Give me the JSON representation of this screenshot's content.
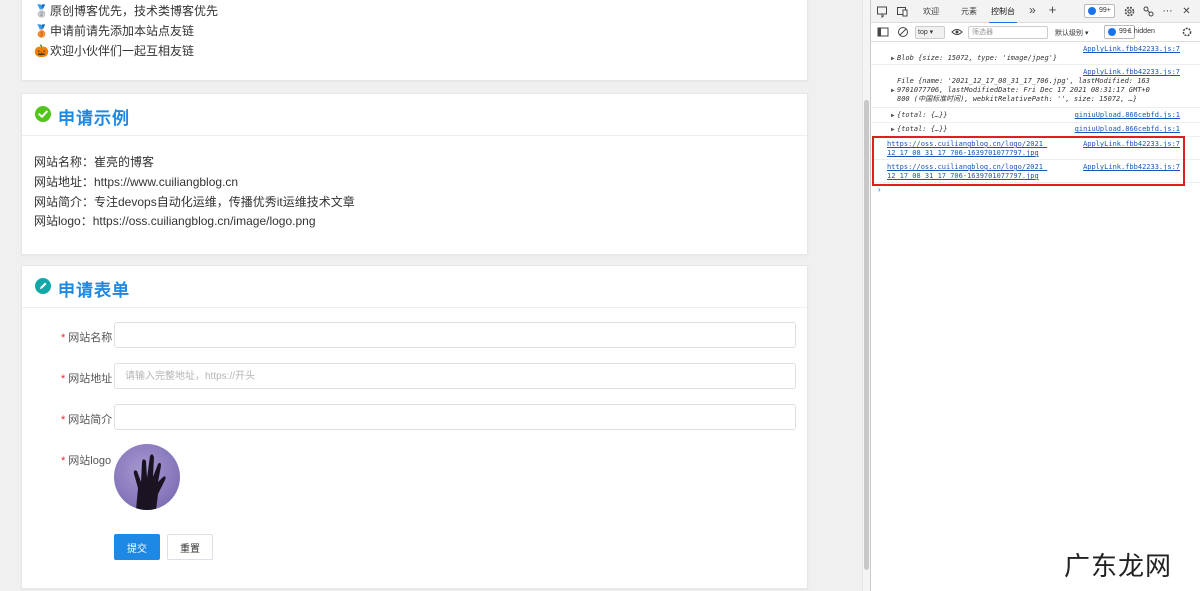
{
  "notices": [
    {
      "icon": "medal-icon",
      "emoji": "🥈",
      "text": "原创博客优先，技术类博客优先"
    },
    {
      "icon": "medal-icon",
      "emoji": "🥉",
      "text": "申请前请先添加本站点友链"
    },
    {
      "icon": "pumpkin-icon",
      "emoji": "🎃",
      "text": "欢迎小伙伴们一起互相友链"
    }
  ],
  "example": {
    "title": "申请示例",
    "lines": [
      "网站名称：崔亮的博客",
      "网站地址：https://www.cuiliangblog.cn",
      "网站简介：专注devops自动化运维，传播优秀it运维技术文章",
      "网站logo：https://oss.cuiliangblog.cn/image/logo.png"
    ]
  },
  "form": {
    "title": "申请表单",
    "required_mark": "*",
    "name_label": "网站名称",
    "name_value": "",
    "url_label": "网站地址",
    "url_placeholder": "请输入完整地址，https://开头",
    "intro_label": "网站简介",
    "intro_value": "",
    "logo_label": "网站logo",
    "submit_label": "提交",
    "reset_label": "重置"
  },
  "devtools": {
    "tabs": [
      "欢迎",
      "元素",
      "控制台"
    ],
    "active_tab": "控制台",
    "more": "»",
    "add": "+",
    "issues_badge": "99+",
    "context": "top",
    "filter_placeholder": "筛选器",
    "levels": "默认级别",
    "levels_badge": "99+",
    "hidden": "1 hidden",
    "logs": [
      {
        "src": "ApplyLink.fbb42233.js:7",
        "text": "Blob {size: 15072, type: 'image/jpeg'}"
      },
      {
        "src": "ApplyLink.fbb42233.js:7",
        "line1": "File {name: '2021_12_17_08_31_17_706.jpg', lastModified: 163",
        "line2": "9701077706, lastModifiedDate: Fri Dec 17 2021 08:31:17 GMT+0",
        "line3": "800 (中国标准时间), webkitRelativePath: '', size: 15072, …}"
      },
      {
        "src": "qiniuUpload.866cebfd.js:1",
        "text": "{total: {…}}"
      },
      {
        "src": "qiniuUpload.866cebfd.js:1",
        "text": "{total: {…}}"
      },
      {
        "src": "ApplyLink.fbb42233.js:7",
        "line1": "https://oss.cuiliangblog.cn/logo/2021_",
        "line2": "12_17_08_31_17_706-1639701077797.jpg"
      },
      {
        "src": "ApplyLink.fbb42233.js:7",
        "line1": "https://oss.cuiliangblog.cn/logo/2021_",
        "line2": "12_17_08_31_17_706-1639701077797.jpg"
      }
    ],
    "prompt": "›"
  },
  "watermark": "广东龙网",
  "colors": {
    "accent": "#1e88e5",
    "highlight": "#e02020"
  }
}
